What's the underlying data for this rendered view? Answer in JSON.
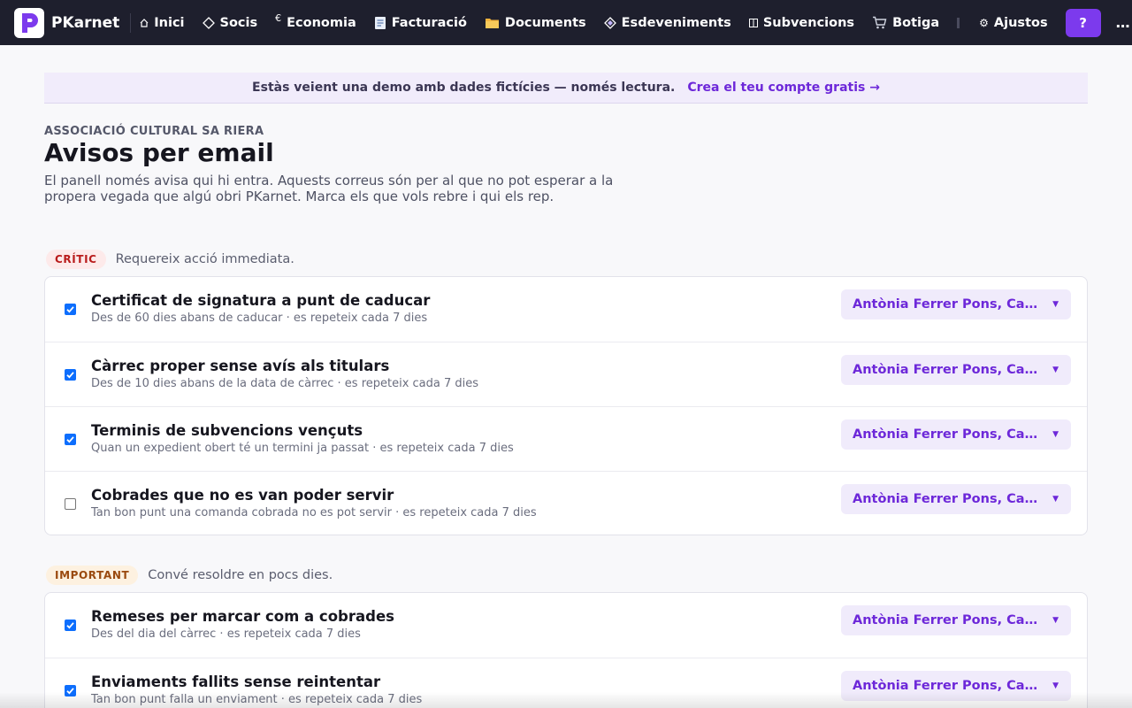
{
  "nav": {
    "brand": "PKarnet",
    "items": [
      {
        "label": "Inici",
        "icon": "home-icon"
      },
      {
        "label": "Socis",
        "icon": "diamond-icon"
      },
      {
        "label": "Economia",
        "icon": "euro-icon"
      },
      {
        "label": "Facturació",
        "icon": "receipt-icon"
      },
      {
        "label": "Documents",
        "icon": "folder-icon"
      },
      {
        "label": "Esdeveniments",
        "icon": "event-icon"
      },
      {
        "label": "Subvencions",
        "icon": "columns-icon"
      },
      {
        "label": "Botiga",
        "icon": "cart-icon"
      }
    ],
    "settings_label": "Ajustos",
    "help_label": "?",
    "more_label": "…"
  },
  "banner": {
    "text": "Estàs veient una demo amb dades fictícies — només lectura.",
    "link": "Crea el teu compte gratis →"
  },
  "header": {
    "org": "ASSOCIACIÓ CULTURAL SA RIERA",
    "title": "Avisos per email",
    "description": "El panell només avisa qui hi entra. Aquests correus són per al que no pot esperar a la propera vegada que algú obri PKarnet. Marca els que vols rebre i qui els rep."
  },
  "sections": [
    {
      "badge": "CRÍTIC",
      "subtitle": "Requereix acció immediata.",
      "rows": [
        {
          "checked": true,
          "title": "Certificat de signatura a punt de caducar",
          "detail": "Des de 60 dies abans de caducar · es repeteix cada 7 dies",
          "recipients": "Antònia Ferrer Pons, Catalina Mas"
        },
        {
          "checked": true,
          "title": "Càrrec proper sense avís als titulars",
          "detail": "Des de 10 dies abans de la data de càrrec · es repeteix cada 7 dies",
          "recipients": "Antònia Ferrer Pons, Catalina Mas"
        },
        {
          "checked": true,
          "title": "Terminis de subvencions vençuts",
          "detail": "Quan un expedient obert té un termini ja passat · es repeteix cada 7 dies",
          "recipients": "Antònia Ferrer Pons, Catalina Mas"
        },
        {
          "checked": false,
          "title": "Cobrades que no es van poder servir",
          "detail": "Tan bon punt una comanda cobrada no es pot servir · es repeteix cada 7 dies",
          "recipients": "Antònia Ferrer Pons, Catalina Mas"
        }
      ]
    },
    {
      "badge": "IMPORTANT",
      "subtitle": "Convé resoldre en pocs dies.",
      "rows": [
        {
          "checked": true,
          "title": "Remeses per marcar com a cobrades",
          "detail": "Des del dia del càrrec · es repeteix cada 7 dies",
          "recipients": "Antònia Ferrer Pons, Catalina Mas"
        },
        {
          "checked": true,
          "title": "Enviaments fallits sense reintentar",
          "detail": "Tan bon punt falla un enviament · es repeteix cada 7 dies",
          "recipients": "Antònia Ferrer Pons, Catalina Mas"
        }
      ]
    }
  ],
  "colors": {
    "topbar": "#1e1f2d",
    "accent": "#7c3aed",
    "critical": "#b91c1c",
    "important": "#9a4a0f",
    "checkbox": "#0d6efd"
  }
}
